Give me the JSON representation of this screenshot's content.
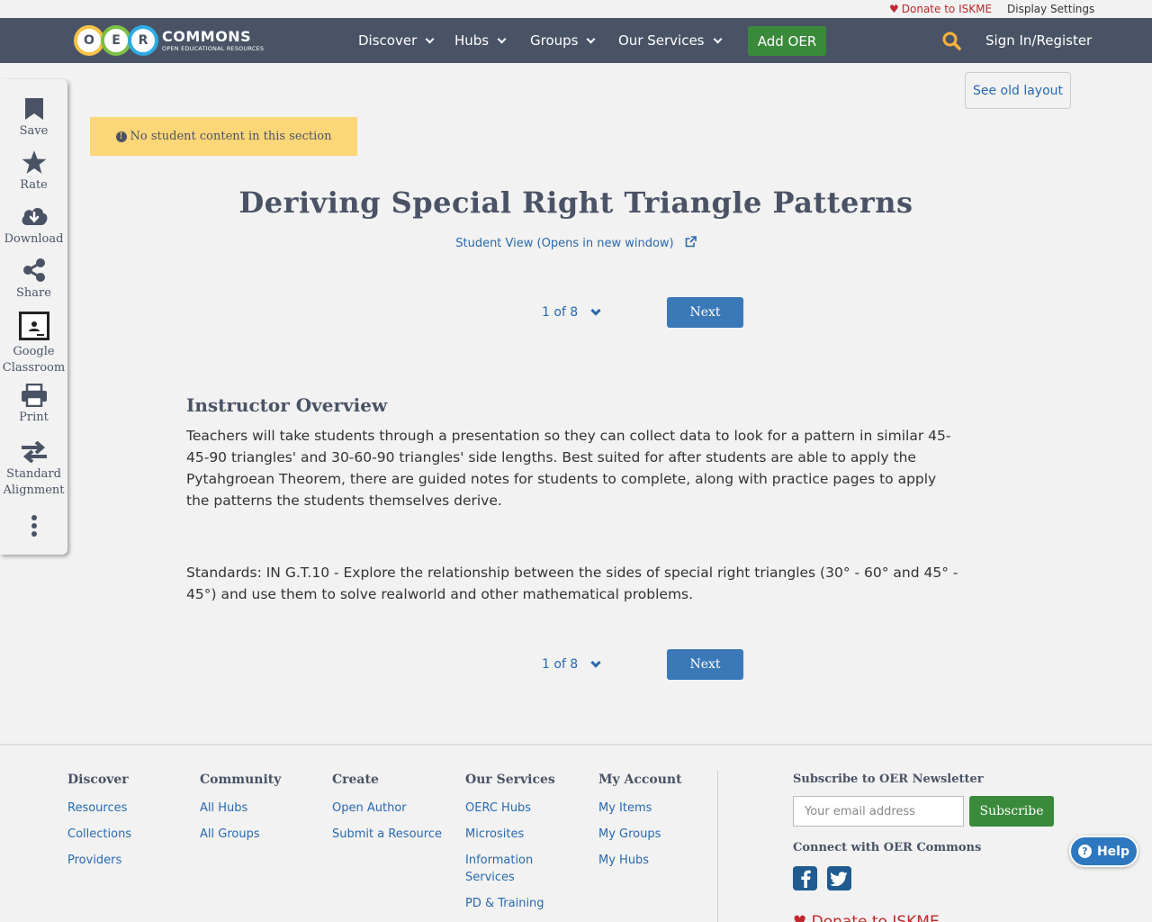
{
  "utility": {
    "donate": "Donate to ISKME",
    "display_settings": "Display Settings"
  },
  "navbar": {
    "logo_letters": [
      "O",
      "E",
      "R"
    ],
    "logo_title": "COMMONS",
    "logo_subtitle": "OPEN EDUCATIONAL RESOURCES",
    "items": [
      {
        "label": "Discover"
      },
      {
        "label": "Hubs"
      },
      {
        "label": "Groups"
      },
      {
        "label": "Our Services"
      }
    ],
    "add_oer": "Add OER",
    "sign_in": "Sign In/Register",
    "colors": {
      "bar": "#4a5366",
      "add_button": "#3a8a3c",
      "search_icon": "#f6b23c"
    }
  },
  "tools": [
    {
      "label": "Save",
      "icon": "bookmark-icon"
    },
    {
      "label": "Rate",
      "icon": "star-icon"
    },
    {
      "label": "Download",
      "icon": "cloud-download-icon"
    },
    {
      "label": "Share",
      "icon": "share-icon"
    },
    {
      "label": "Google Classroom",
      "icon": "google-classroom-icon"
    },
    {
      "label": "Print",
      "icon": "print-icon"
    },
    {
      "label": "Standard Alignment",
      "icon": "exchange-icon"
    },
    {
      "label": "",
      "icon": "more-vertical-icon"
    }
  ],
  "see_old_layout": "See old layout",
  "notice": "No student content in this section",
  "page_title": "Deriving Special Right Triangle Patterns",
  "student_view": "Student View (Opens in new window)",
  "pager": {
    "current": "1 of 8",
    "next": "Next"
  },
  "section": {
    "heading": "Instructor Overview",
    "overview": "Teachers will take students through a presentation so they can collect data to look for a pattern in similar 45-45-90 triangles' and 30-60-90 triangles' side lengths.  Best suited for after students are able to apply the Pytahgroean Theorem, there are guided notes for students to complete, along with practice pages to apply the patterns the students themselves derive.",
    "standards": "Standards: IN G.T.10 - Explore the relationship between the sides of special right triangles (30° - 60° and 45° - 45°) and use them to solve realworld and other mathematical problems."
  },
  "footer": {
    "columns": [
      {
        "title": "Discover",
        "links": [
          "Resources",
          "Collections",
          "Providers"
        ]
      },
      {
        "title": "Community",
        "links": [
          "All Hubs",
          "All Groups"
        ]
      },
      {
        "title": "Create",
        "links": [
          "Open Author",
          "Submit a Resource"
        ]
      },
      {
        "title": "Our Services",
        "links": [
          "OERC Hubs",
          "Microsites",
          "Information Services",
          "PD & Training"
        ]
      },
      {
        "title": "My Account",
        "links": [
          "My Items",
          "My Groups",
          "My Hubs"
        ]
      }
    ],
    "newsletter_title": "Subscribe to OER Newsletter",
    "email_placeholder": "Your email address",
    "subscribe": "Subscribe",
    "connect_title": "Connect with OER Commons",
    "social": [
      "facebook-icon",
      "twitter-icon"
    ],
    "donate": "Donate to ISKME"
  },
  "help": "Help"
}
